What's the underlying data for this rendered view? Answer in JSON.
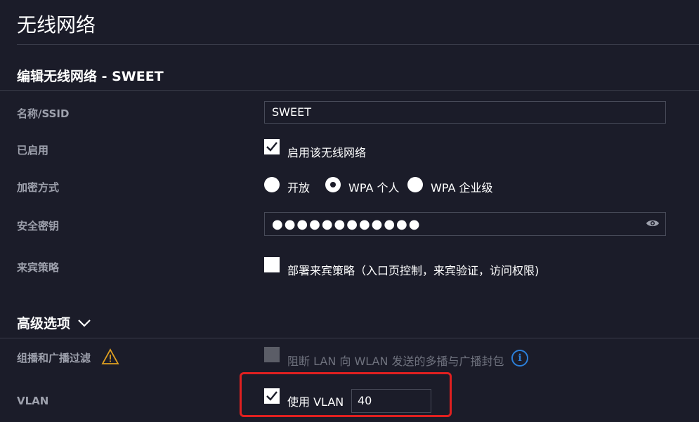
{
  "page": {
    "title": "无线网络"
  },
  "form": {
    "section_title": "编辑无线网络 - SWEET",
    "name": {
      "label": "名称/SSID",
      "value": "SWEET"
    },
    "enabled": {
      "label": "已启用",
      "checkbox_label": "启用该无线网络",
      "checked": true
    },
    "security": {
      "label": "加密方式",
      "options": [
        "开放",
        "WPA 个人",
        "WPA 企业级"
      ],
      "selected": "WPA 个人"
    },
    "key": {
      "label": "安全密钥",
      "masked_value": "●●●●●●●●●●●●",
      "icon": "eye-icon"
    },
    "guest": {
      "label": "来宾策略",
      "checkbox_label": "部署来宾策略（入口页控制，来宾验证，访问权限)",
      "checked": false
    }
  },
  "advanced": {
    "title": "高级选项",
    "icon": "chevron-down-icon",
    "multicast": {
      "label": "组播和广播过滤",
      "warning_icon": "warning-icon",
      "checkbox_label": "阻断 LAN 向 WLAN 发送的多播与广播封包",
      "checked": false,
      "disabled": true,
      "info_icon": "info-icon",
      "info_glyph": "i"
    },
    "vlan": {
      "label": "VLAN",
      "checkbox_label": "使用 VLAN",
      "checked": true,
      "value": "40"
    }
  },
  "colors": {
    "background": "#1b1c29",
    "label": "#9ea1ad",
    "border": "#474a58",
    "highlight": "#e02020",
    "info": "#2b7fd9",
    "warning": "#e0a020"
  }
}
